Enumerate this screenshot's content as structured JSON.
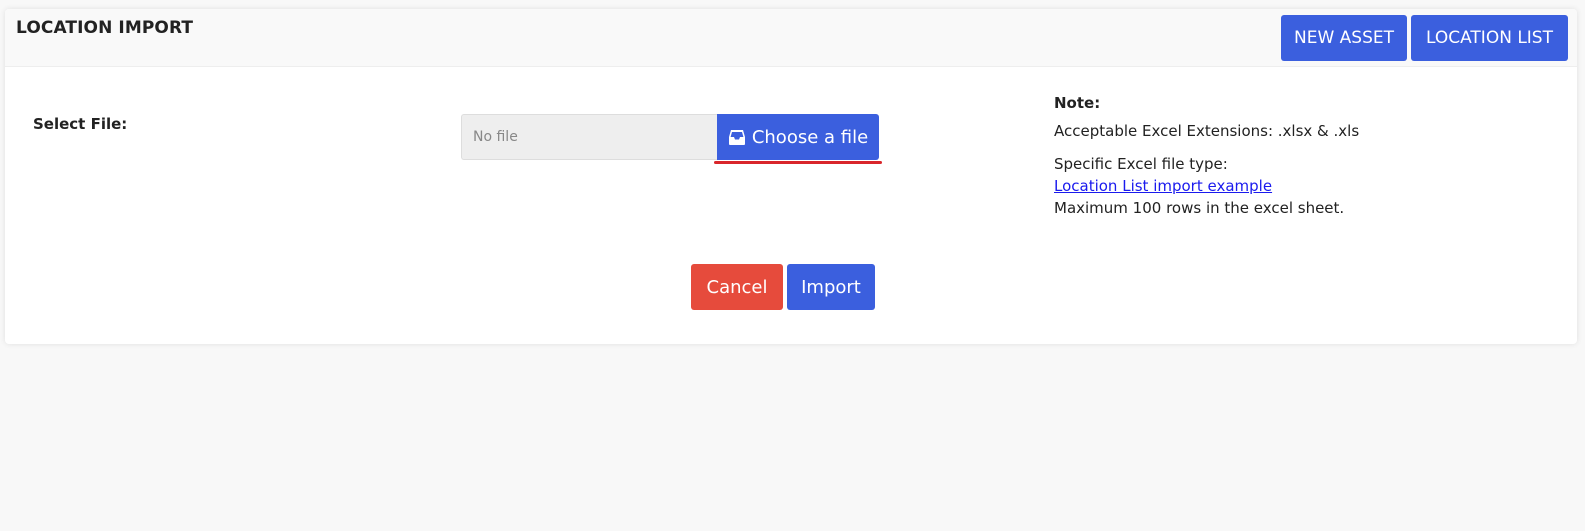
{
  "header": {
    "title": "LOCATION IMPORT",
    "new_asset_label": "NEW ASSET",
    "location_list_label": "LOCATION LIST"
  },
  "form": {
    "select_file_label": "Select File:",
    "file_placeholder": "No file",
    "choose_file_label": "Choose a file",
    "cancel_label": "Cancel",
    "import_label": "Import"
  },
  "note": {
    "title": "Note:",
    "extensions": "Acceptable Excel Extensions: .xlsx & .xls",
    "file_type": "Specific Excel file type:",
    "example_link": "Location List import example",
    "max_rows": "Maximum 100 rows in the excel sheet."
  },
  "icons": {
    "choose_file_icon": "inbox-tray-icon"
  },
  "colors": {
    "primary": "#3b5fde",
    "danger": "#e64b3c",
    "underline": "#d9262b",
    "link": "#1a1aee"
  }
}
